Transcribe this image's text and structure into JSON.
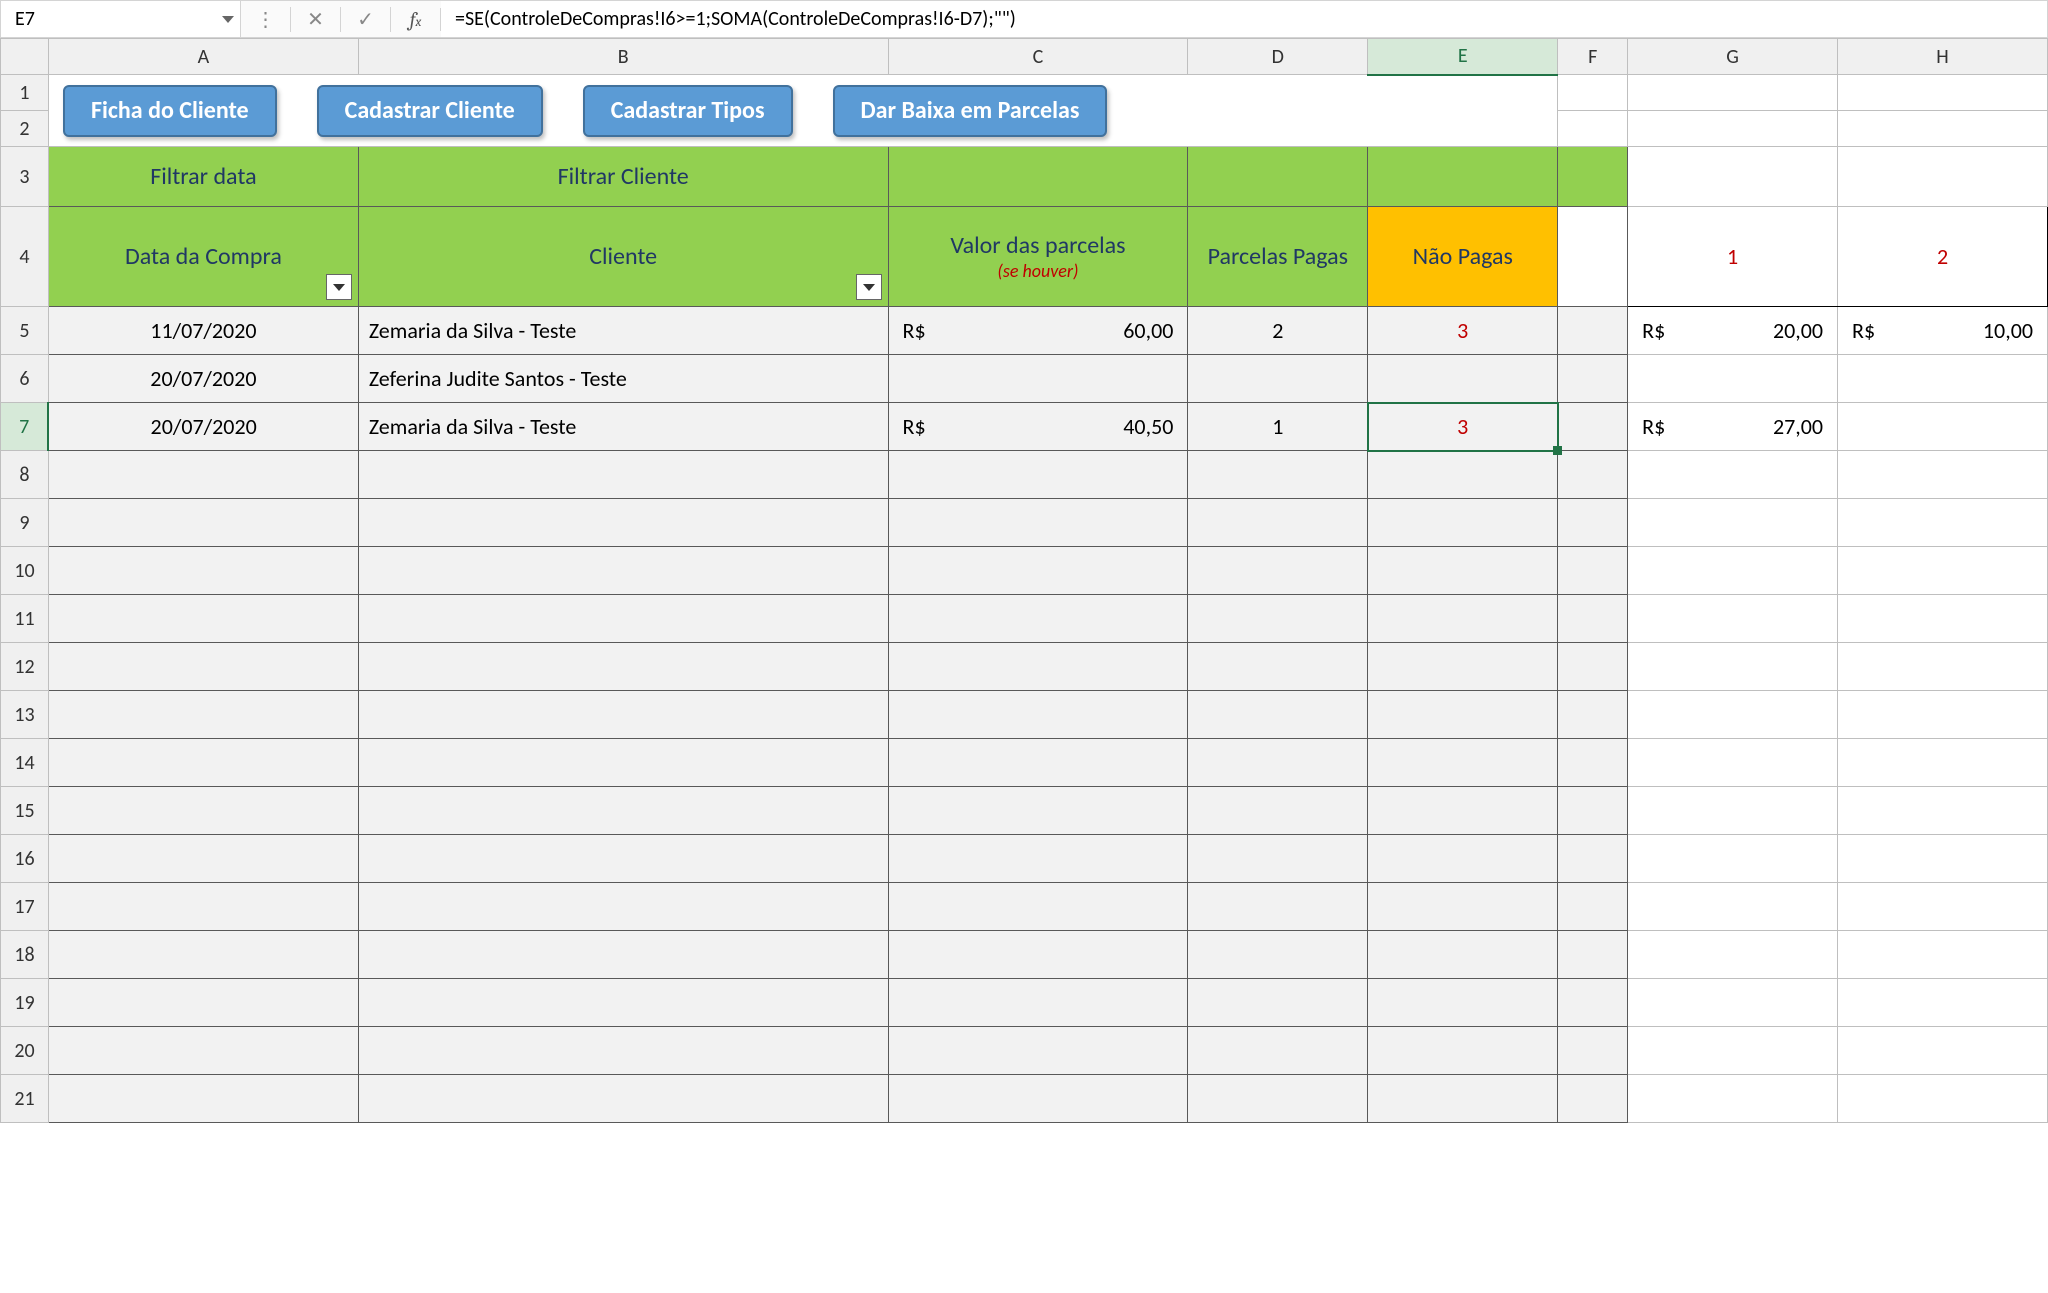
{
  "formula_bar": {
    "cell_ref": "E7",
    "formula": "=SE(ControleDeCompras!I6>=1;SOMA(ControleDeCompras!I6-D7);\"\")"
  },
  "columns": [
    "A",
    "B",
    "C",
    "D",
    "E",
    "F",
    "G",
    "H"
  ],
  "rows": [
    "1",
    "2",
    "3",
    "4",
    "5",
    "6",
    "7",
    "8",
    "9",
    "10",
    "11",
    "12",
    "13",
    "14",
    "15",
    "16",
    "17",
    "18",
    "19",
    "20",
    "21"
  ],
  "selected_cell": "E7",
  "buttons": {
    "ficha": "Ficha do Cliente",
    "cadastrar_cliente": "Cadastrar Cliente",
    "cadastrar_tipos": "Cadastrar Tipos",
    "dar_baixa": "Dar Baixa em Parcelas"
  },
  "filters": {
    "data_label": "Filtrar data",
    "cliente_label": "Filtrar Cliente"
  },
  "table_headers": {
    "data": "Data da Compra",
    "cliente": "Cliente",
    "valor_parcelas": "Valor das parcelas",
    "valor_parcelas_sub": "(se houver)",
    "parcelas_pagas": "Parcelas Pagas",
    "nao_pagas": "Não Pagas",
    "col_g": "1",
    "col_h": "2"
  },
  "rows_data": [
    {
      "data": "11/07/2020",
      "cliente": "Zemaria da Silva - Teste",
      "valor_prefix": "R$",
      "valor": "60,00",
      "parcelas_pagas": "2",
      "nao_pagas": "3",
      "g_prefix": "R$",
      "g_val": "20,00",
      "h_prefix": "R$",
      "h_val": "10,00"
    },
    {
      "data": "20/07/2020",
      "cliente": "Zeferina Judite Santos - Teste",
      "valor_prefix": "",
      "valor": "",
      "parcelas_pagas": "",
      "nao_pagas": "",
      "g_prefix": "",
      "g_val": "",
      "h_prefix": "",
      "h_val": ""
    },
    {
      "data": "20/07/2020",
      "cliente": "Zemaria da Silva - Teste",
      "valor_prefix": "R$",
      "valor": "40,50",
      "parcelas_pagas": "1",
      "nao_pagas": "3",
      "g_prefix": "R$",
      "g_val": "27,00",
      "h_prefix": "",
      "h_val": ""
    }
  ]
}
